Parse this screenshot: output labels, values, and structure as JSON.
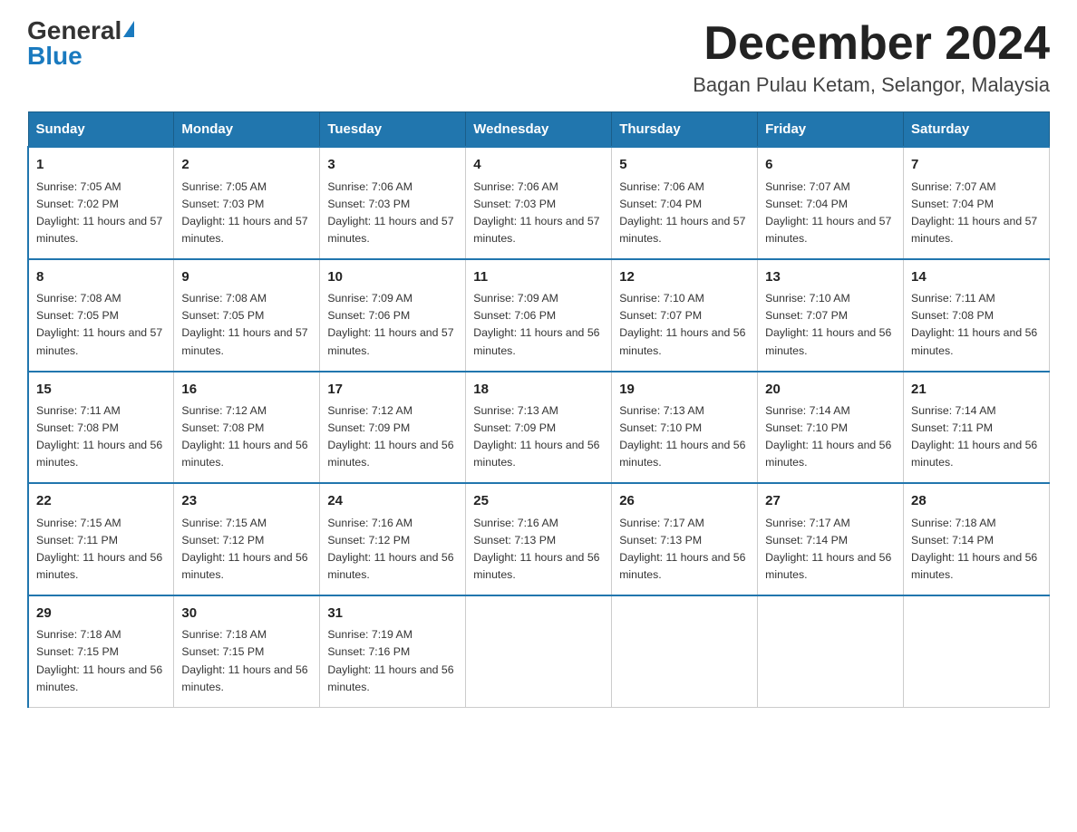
{
  "header": {
    "logo_general": "General",
    "logo_blue": "Blue",
    "month_year": "December 2024",
    "location": "Bagan Pulau Ketam, Selangor, Malaysia"
  },
  "days_of_week": [
    "Sunday",
    "Monday",
    "Tuesday",
    "Wednesday",
    "Thursday",
    "Friday",
    "Saturday"
  ],
  "weeks": [
    [
      {
        "day": "1",
        "sunrise": "7:05 AM",
        "sunset": "7:02 PM",
        "daylight": "11 hours and 57 minutes."
      },
      {
        "day": "2",
        "sunrise": "7:05 AM",
        "sunset": "7:03 PM",
        "daylight": "11 hours and 57 minutes."
      },
      {
        "day": "3",
        "sunrise": "7:06 AM",
        "sunset": "7:03 PM",
        "daylight": "11 hours and 57 minutes."
      },
      {
        "day": "4",
        "sunrise": "7:06 AM",
        "sunset": "7:03 PM",
        "daylight": "11 hours and 57 minutes."
      },
      {
        "day": "5",
        "sunrise": "7:06 AM",
        "sunset": "7:04 PM",
        "daylight": "11 hours and 57 minutes."
      },
      {
        "day": "6",
        "sunrise": "7:07 AM",
        "sunset": "7:04 PM",
        "daylight": "11 hours and 57 minutes."
      },
      {
        "day": "7",
        "sunrise": "7:07 AM",
        "sunset": "7:04 PM",
        "daylight": "11 hours and 57 minutes."
      }
    ],
    [
      {
        "day": "8",
        "sunrise": "7:08 AM",
        "sunset": "7:05 PM",
        "daylight": "11 hours and 57 minutes."
      },
      {
        "day": "9",
        "sunrise": "7:08 AM",
        "sunset": "7:05 PM",
        "daylight": "11 hours and 57 minutes."
      },
      {
        "day": "10",
        "sunrise": "7:09 AM",
        "sunset": "7:06 PM",
        "daylight": "11 hours and 57 minutes."
      },
      {
        "day": "11",
        "sunrise": "7:09 AM",
        "sunset": "7:06 PM",
        "daylight": "11 hours and 56 minutes."
      },
      {
        "day": "12",
        "sunrise": "7:10 AM",
        "sunset": "7:07 PM",
        "daylight": "11 hours and 56 minutes."
      },
      {
        "day": "13",
        "sunrise": "7:10 AM",
        "sunset": "7:07 PM",
        "daylight": "11 hours and 56 minutes."
      },
      {
        "day": "14",
        "sunrise": "7:11 AM",
        "sunset": "7:08 PM",
        "daylight": "11 hours and 56 minutes."
      }
    ],
    [
      {
        "day": "15",
        "sunrise": "7:11 AM",
        "sunset": "7:08 PM",
        "daylight": "11 hours and 56 minutes."
      },
      {
        "day": "16",
        "sunrise": "7:12 AM",
        "sunset": "7:08 PM",
        "daylight": "11 hours and 56 minutes."
      },
      {
        "day": "17",
        "sunrise": "7:12 AM",
        "sunset": "7:09 PM",
        "daylight": "11 hours and 56 minutes."
      },
      {
        "day": "18",
        "sunrise": "7:13 AM",
        "sunset": "7:09 PM",
        "daylight": "11 hours and 56 minutes."
      },
      {
        "day": "19",
        "sunrise": "7:13 AM",
        "sunset": "7:10 PM",
        "daylight": "11 hours and 56 minutes."
      },
      {
        "day": "20",
        "sunrise": "7:14 AM",
        "sunset": "7:10 PM",
        "daylight": "11 hours and 56 minutes."
      },
      {
        "day": "21",
        "sunrise": "7:14 AM",
        "sunset": "7:11 PM",
        "daylight": "11 hours and 56 minutes."
      }
    ],
    [
      {
        "day": "22",
        "sunrise": "7:15 AM",
        "sunset": "7:11 PM",
        "daylight": "11 hours and 56 minutes."
      },
      {
        "day": "23",
        "sunrise": "7:15 AM",
        "sunset": "7:12 PM",
        "daylight": "11 hours and 56 minutes."
      },
      {
        "day": "24",
        "sunrise": "7:16 AM",
        "sunset": "7:12 PM",
        "daylight": "11 hours and 56 minutes."
      },
      {
        "day": "25",
        "sunrise": "7:16 AM",
        "sunset": "7:13 PM",
        "daylight": "11 hours and 56 minutes."
      },
      {
        "day": "26",
        "sunrise": "7:17 AM",
        "sunset": "7:13 PM",
        "daylight": "11 hours and 56 minutes."
      },
      {
        "day": "27",
        "sunrise": "7:17 AM",
        "sunset": "7:14 PM",
        "daylight": "11 hours and 56 minutes."
      },
      {
        "day": "28",
        "sunrise": "7:18 AM",
        "sunset": "7:14 PM",
        "daylight": "11 hours and 56 minutes."
      }
    ],
    [
      {
        "day": "29",
        "sunrise": "7:18 AM",
        "sunset": "7:15 PM",
        "daylight": "11 hours and 56 minutes."
      },
      {
        "day": "30",
        "sunrise": "7:18 AM",
        "sunset": "7:15 PM",
        "daylight": "11 hours and 56 minutes."
      },
      {
        "day": "31",
        "sunrise": "7:19 AM",
        "sunset": "7:16 PM",
        "daylight": "11 hours and 56 minutes."
      },
      null,
      null,
      null,
      null
    ]
  ]
}
